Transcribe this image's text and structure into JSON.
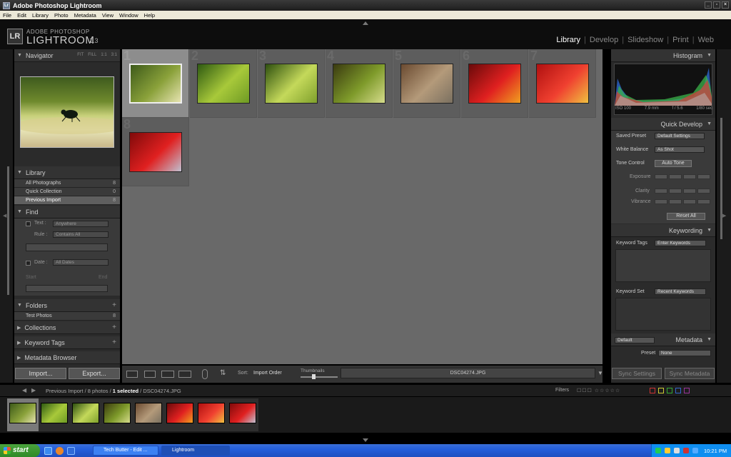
{
  "window": {
    "title": "Adobe Photoshop Lightroom",
    "buttons": [
      "_",
      "▫",
      "×"
    ]
  },
  "menu": [
    "File",
    "Edit",
    "Library",
    "Photo",
    "Metadata",
    "View",
    "Window",
    "Help"
  ],
  "identity": {
    "logo": "LR",
    "line1": "ADOBE PHOTOSHOP",
    "line2": "LIGHTROOM",
    "version": "1.3"
  },
  "modules": [
    "Library",
    "Develop",
    "Slideshow",
    "Print",
    "Web"
  ],
  "active_module": "Library",
  "left": {
    "navigator": {
      "title": "Navigator",
      "zoom": [
        "FIT",
        "FILL",
        "1:1",
        "3:1"
      ]
    },
    "library": {
      "title": "Library",
      "items": [
        {
          "label": "All Photographs",
          "count": "8"
        },
        {
          "label": "Quick Collection",
          "count": "0"
        },
        {
          "label": "Previous Import",
          "count": "8"
        }
      ]
    },
    "find": {
      "title": "Find",
      "text_label": "Text :",
      "text_value": "Anywhere",
      "rule_label": "Rule :",
      "rule_value": "Contains All",
      "date_label": "Date :",
      "date_value": "All Dates",
      "start_label": "Start",
      "end_label": "End"
    },
    "folders": {
      "title": "Folders",
      "items": [
        {
          "label": "Test Photos",
          "count": "8"
        }
      ]
    },
    "collections": {
      "title": "Collections"
    },
    "keyword_tags": {
      "title": "Keyword Tags"
    },
    "metadata_browser": {
      "title": "Metadata Browser"
    },
    "import_label": "Import...",
    "export_label": "Export..."
  },
  "grid": {
    "cells": [
      {
        "num": "1",
        "colors": [
          "#3d5a1a",
          "#8aa13a",
          "#e6e3b0"
        ],
        "selected": true
      },
      {
        "num": "2",
        "colors": [
          "#2f5a12",
          "#a8c93a",
          "#6e9a24"
        ]
      },
      {
        "num": "3",
        "colors": [
          "#2e4f0f",
          "#c4d95a",
          "#7fa02c"
        ]
      },
      {
        "num": "4",
        "colors": [
          "#3a3a10",
          "#7e9a2a",
          "#d6dc8c"
        ]
      },
      {
        "num": "5",
        "colors": [
          "#6a4a30",
          "#b49a7a",
          "#7a7060"
        ]
      },
      {
        "num": "6",
        "colors": [
          "#6a0a0a",
          "#e02020",
          "#f0a020"
        ]
      },
      {
        "num": "7",
        "colors": [
          "#b01010",
          "#f04030",
          "#f0c040"
        ]
      },
      {
        "num": "8",
        "colors": [
          "#800a0a",
          "#e02020",
          "#c0c0d0"
        ]
      }
    ]
  },
  "toolbar": {
    "sort_label": "Sort:",
    "sort_value": "Import Order",
    "thumbnails_label": "Thumbnails",
    "filename": "DSC04274.JPG"
  },
  "right": {
    "histogram": {
      "title": "Histogram",
      "iso": "ISO 100",
      "focal": "7.9 mm",
      "aperture": "f / 5.6",
      "shutter": "1/80 sec"
    },
    "quick_develop": {
      "title": "Quick Develop",
      "saved_preset_label": "Saved Preset",
      "saved_preset_value": "Default Settings",
      "wb_label": "White Balance",
      "wb_value": "As Shot",
      "tone_label": "Tone Control",
      "auto_tone": "Auto Tone",
      "exposure": "Exposure",
      "clarity": "Clarity",
      "vibrance": "Vibrance",
      "reset": "Reset All"
    },
    "keywording": {
      "title": "Keywording",
      "tags_label": "Keyword Tags",
      "tags_value": "Enter Keywords",
      "set_label": "Keyword Set",
      "set_value": "Recent Keywords"
    },
    "metadata": {
      "title": "Metadata",
      "preset_dropdown": "Default",
      "preset_label": "Preset",
      "preset_value": "None"
    },
    "sync_settings": "Sync Settings",
    "sync_metadata": "Sync Metadata"
  },
  "filmstrip": {
    "source": "Previous Import / 8 photos / ",
    "selected": "1 selected",
    "file": " / DSC04274.JPG",
    "filters_label": "Filters"
  },
  "taskbar": {
    "start": "start",
    "tasks": [
      {
        "label": "Tech Butter - Edit ...",
        "active": false
      },
      {
        "label": "Lightroom",
        "active": true
      }
    ],
    "clock": "10:21 PM"
  }
}
